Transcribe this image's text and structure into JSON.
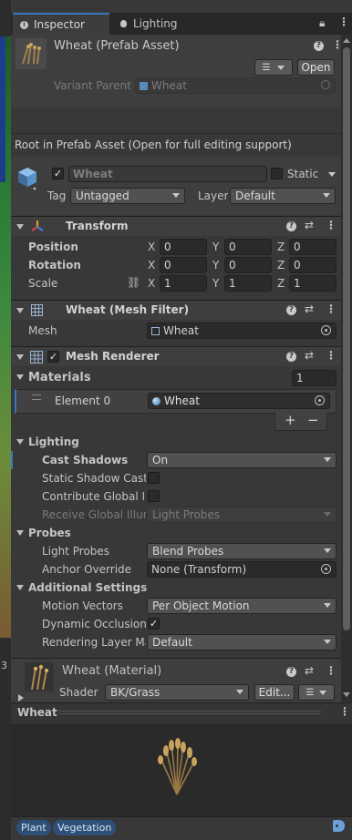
{
  "tabs": {
    "inspector": "Inspector",
    "lighting": "Lighting"
  },
  "header": {
    "title": "Wheat (Prefab Asset)",
    "open_label": "Open",
    "variant_parent_label": "Variant Parent",
    "variant_parent_value": "Wheat"
  },
  "notice": "Root in Prefab Asset (Open for full editing support)",
  "gameobject": {
    "name": "Wheat",
    "static_label": "Static",
    "tag_label": "Tag",
    "tag_value": "Untagged",
    "layer_label": "Layer",
    "layer_value": "Default"
  },
  "transform": {
    "title": "Transform",
    "position_label": "Position",
    "rotation_label": "Rotation",
    "scale_label": "Scale",
    "position": {
      "x": "0",
      "y": "0",
      "z": "0"
    },
    "rotation": {
      "x": "0",
      "y": "0",
      "z": "0"
    },
    "scale": {
      "x": "1",
      "y": "1",
      "z": "1"
    },
    "axis": {
      "x": "X",
      "y": "Y",
      "z": "Z"
    }
  },
  "mesh_filter": {
    "title": "Wheat (Mesh Filter)",
    "mesh_label": "Mesh",
    "mesh_value": "Wheat"
  },
  "mesh_renderer": {
    "title": "Mesh Renderer",
    "materials_label": "Materials",
    "materials_count": "1",
    "element0_label": "Element 0",
    "element0_value": "Wheat",
    "plus": "+",
    "minus": "−",
    "lighting_label": "Lighting",
    "cast_shadows_label": "Cast Shadows",
    "cast_shadows_value": "On",
    "static_shadow_label": "Static Shadow Caste",
    "contribute_gi_label": "Contribute Global Illu",
    "receive_gi_label": "Receive Global Illum",
    "receive_gi_value": "Light Probes",
    "probes_label": "Probes",
    "light_probes_label": "Light Probes",
    "light_probes_value": "Blend Probes",
    "anchor_override_label": "Anchor Override",
    "anchor_override_value": "None (Transform)",
    "additional_label": "Additional Settings",
    "motion_vectors_label": "Motion Vectors",
    "motion_vectors_value": "Per Object Motion",
    "dynamic_occlusion_label": "Dynamic Occlusion",
    "rendering_layer_label": "Rendering Layer Ma",
    "rendering_layer_value": "Default"
  },
  "material": {
    "title": "Wheat (Material)",
    "shader_label": "Shader",
    "shader_value": "BK/Grass",
    "edit_label": "Edit..."
  },
  "preview": {
    "title": "Wheat"
  },
  "labels": [
    "Plant",
    "Vegetation"
  ],
  "side_number": "3",
  "colors": {
    "accent": "#3a79bb",
    "header": "#3e3e3e",
    "panel": "#383838"
  }
}
